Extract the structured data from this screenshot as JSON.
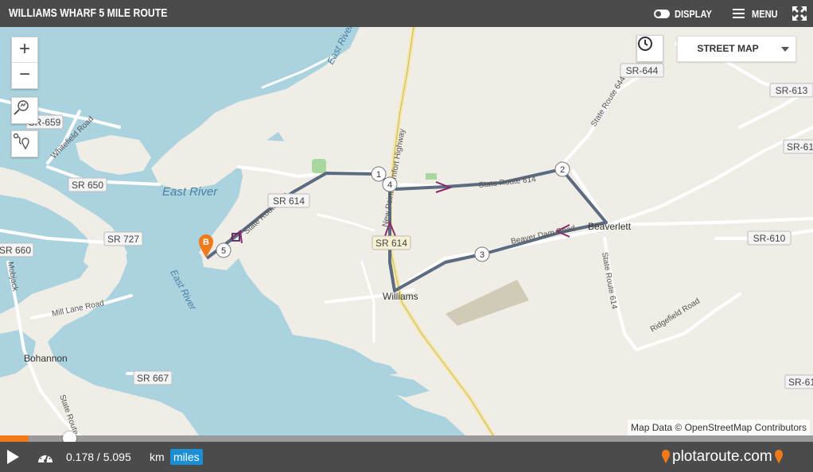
{
  "header": {
    "title": "WILLIAMS WHARF 5 MILE ROUTE",
    "display_label": "DISPLAY",
    "menu_label": "MENU"
  },
  "map": {
    "basemap_selected": "STREET MAP",
    "attribution": "Map Data © OpenStreetMap Contributors",
    "labels": {
      "east_river_1": "East River",
      "east_river_2": "East River",
      "east_river_3": "East River",
      "williams": "Williams",
      "beaverlett": "Beaverlett",
      "bohannon": "Bohannon",
      "mobjack": "Mobjack",
      "whitefield_road": "Whitefield Road",
      "mill_lane_road": "Mill Lane Road",
      "ridgefield_road": "Ridgefield Road",
      "state_route_644": "State Route 644",
      "state_route_614_a": "State Route 614",
      "state_route_614_b": "State Route 614",
      "state_route_614_c": "State Route 614",
      "beaver_dam_road": "Beaver Dam Road",
      "state_route_a": "State Route",
      "new_point_comfort_highway": "New Point Comfort Highway"
    },
    "badges": {
      "sr659": "SR-659",
      "sr650": "SR 650",
      "sr727": "SR 727",
      "sr660": "SR 660",
      "sr667": "SR 667",
      "sr614a": "SR 614",
      "sr614b": "SR 614",
      "sr644": "SR-644",
      "sr613": "SR-613",
      "sr61a": "SR-61",
      "sr610": "SR-610",
      "sr61b": "SR-61"
    },
    "markers": {
      "m1": "1",
      "m2": "2",
      "m3": "3",
      "m4": "4",
      "m5": "5",
      "end": "B"
    },
    "route_color": "#5b6b80",
    "arrow_color": "#8a2a6a",
    "water_color": "#aad3df",
    "marker_color": "#f07a1a"
  },
  "controls": {
    "zoom_in": "+",
    "zoom_out": "−"
  },
  "playback": {
    "progress_fraction": 0.035,
    "distance_text": "0.178 / 5.095",
    "unit_km": "km",
    "unit_miles": "miles",
    "logo_text": "plotaroute.com"
  },
  "colors": {
    "bar": "#4b4b4b",
    "accent_orange": "#f07a1a",
    "accent_blue": "#1a8fd6"
  }
}
